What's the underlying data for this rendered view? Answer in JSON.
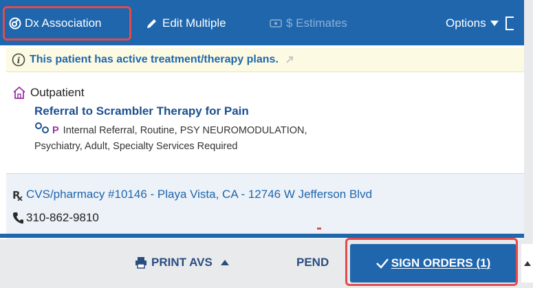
{
  "toolbar": {
    "dx_association": "Dx Association",
    "edit_multiple": "Edit Multiple",
    "estimates": "$ Estimates",
    "options": "Options"
  },
  "banner": {
    "text": "This patient has active treatment/therapy plans."
  },
  "order": {
    "setting": "Outpatient",
    "title": "Referral to Scrambler Therapy for Pain",
    "priority_badge": "P",
    "details_line1": "Internal Referral, Routine, PSY NEUROMODULATION,",
    "details_line2": "Psychiatry, Adult, Specialty Services Required"
  },
  "pharmacy": {
    "name": "CVS/pharmacy #10146 - Playa Vista, CA - 12746 W Jefferson Blvd",
    "phone": "310-862-9810"
  },
  "footer": {
    "print_avs": "PRINT AVS",
    "pend": "PEND",
    "sign_orders": "SIGN ORDERS (1)"
  },
  "colors": {
    "toolbar_blue": "#1f66ad",
    "highlight_red": "#e14b4b",
    "banner_yellow": "#fcfae2",
    "priority_purple": "#9b2fa3"
  },
  "icons": [
    "dx-association-icon",
    "pencil-icon",
    "estimate-card-icon",
    "caret-down-icon",
    "info-icon",
    "home-icon",
    "referral-icon",
    "rx-icon",
    "phone-icon",
    "printer-icon",
    "check-icon"
  ]
}
